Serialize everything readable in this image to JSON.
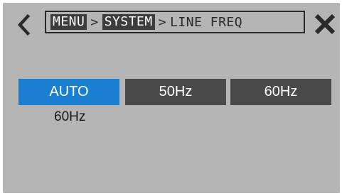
{
  "header": {
    "back_icon": "chevron-left-icon",
    "close_icon": "x-icon",
    "breadcrumb": {
      "menu": "MENU",
      "separator": ">",
      "system": "SYSTEM",
      "current": "LINE FREQ"
    }
  },
  "options": [
    {
      "label": "AUTO",
      "selected": true
    },
    {
      "label": "50Hz",
      "selected": false
    },
    {
      "label": "60Hz",
      "selected": false
    }
  ],
  "current_value": "60Hz",
  "colors": {
    "background": "#b5b5b5",
    "button": "#4a4a4a",
    "selected": "#1a7fd0",
    "text_dark": "#2a2a2a"
  }
}
